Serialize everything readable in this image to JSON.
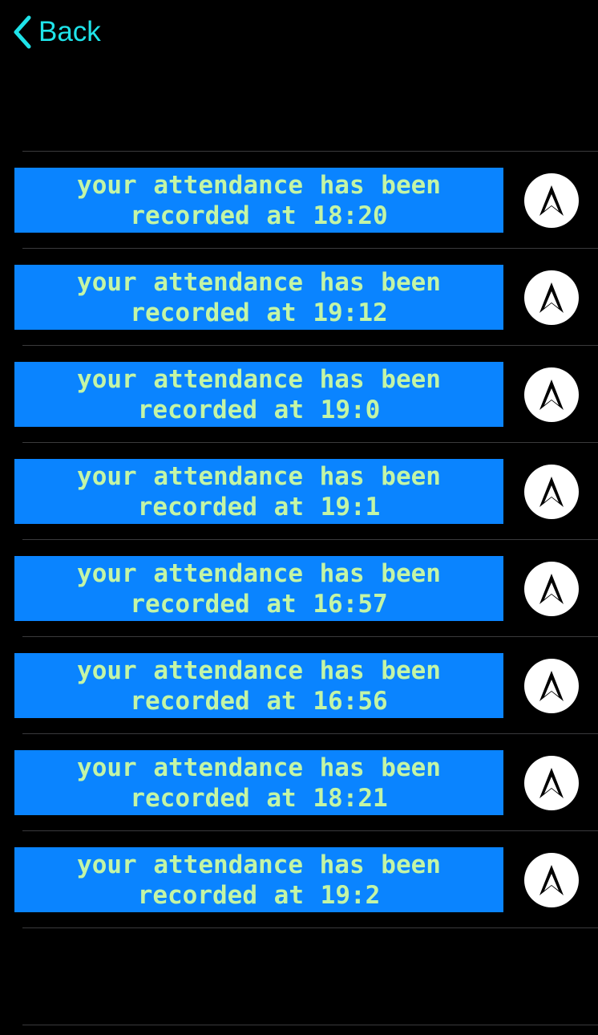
{
  "nav": {
    "back_label": "Back",
    "back_icon": "chevron-left-icon",
    "accent_color": "#1fe3e9"
  },
  "colors": {
    "background": "#000000",
    "message_background": "#0a84ff",
    "message_text": "#c3f5a6",
    "separator": "#3a3a3c"
  },
  "items": [
    {
      "text": "your attendance has been recorded at 18:20",
      "icon": "navigation-arrow-icon"
    },
    {
      "text": "your attendance has been recorded at 19:12",
      "icon": "navigation-arrow-icon"
    },
    {
      "text": "your attendance has been recorded at 19:0",
      "icon": "navigation-arrow-icon"
    },
    {
      "text": "your attendance has been recorded at 19:1",
      "icon": "navigation-arrow-icon"
    },
    {
      "text": "your attendance has been recorded at 16:57",
      "icon": "navigation-arrow-icon"
    },
    {
      "text": "your attendance has been recorded at 16:56",
      "icon": "navigation-arrow-icon"
    },
    {
      "text": "your attendance has been recorded at 18:21",
      "icon": "navigation-arrow-icon"
    },
    {
      "text": "your attendance has been recorded at 19:2",
      "icon": "navigation-arrow-icon"
    }
  ]
}
